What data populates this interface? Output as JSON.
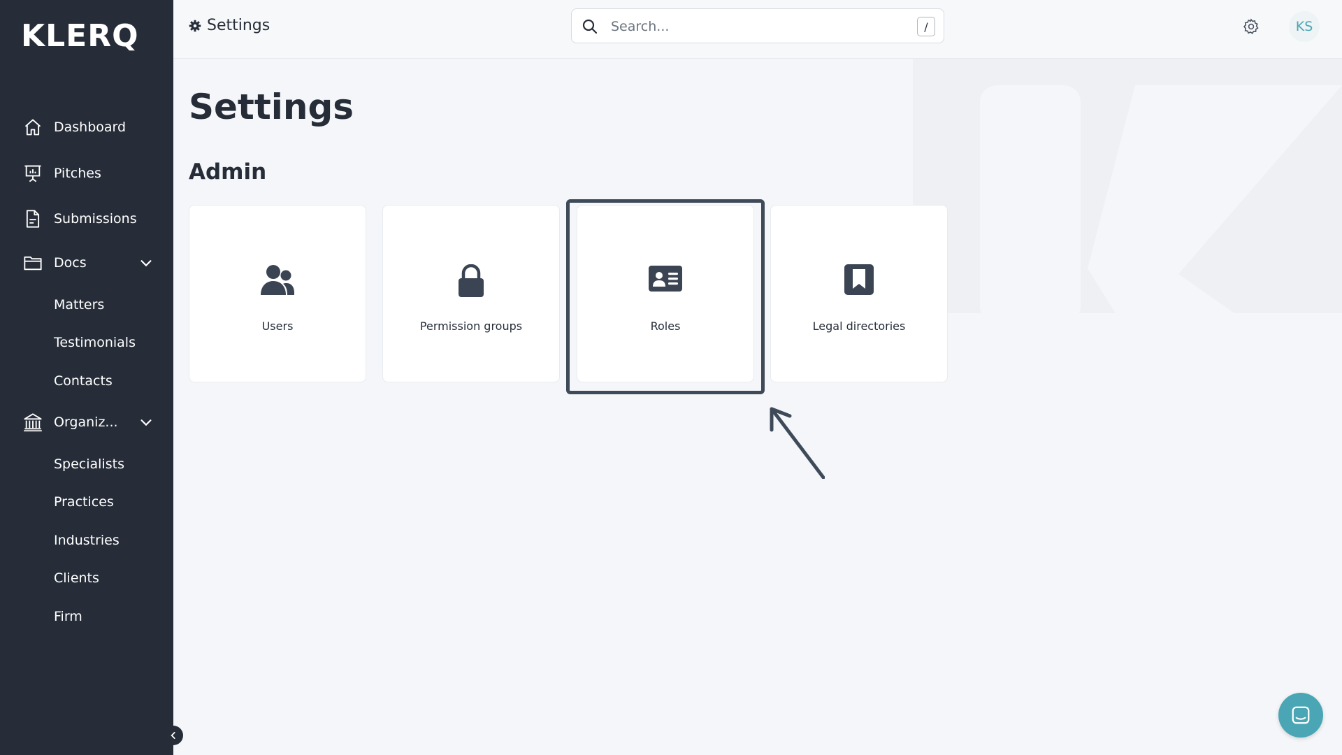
{
  "app": {
    "logo": "KLERQ"
  },
  "sidebar": {
    "items": [
      {
        "label": "Dashboard",
        "icon": "home-icon"
      },
      {
        "label": "Pitches",
        "icon": "presentation-icon"
      },
      {
        "label": "Submissions",
        "icon": "document-icon"
      },
      {
        "label": "Docs",
        "icon": "folder-icon",
        "expanded": true,
        "children": [
          "Matters",
          "Testimonials",
          "Contacts"
        ]
      },
      {
        "label": "Organiz...",
        "icon": "building-icon",
        "expanded": true,
        "children": [
          "Specialists",
          "Practices",
          "Industries",
          "Clients",
          "Firm"
        ]
      }
    ]
  },
  "header": {
    "breadcrumb": "Settings",
    "search": {
      "placeholder": "Search...",
      "shortcut": "/"
    },
    "avatar_initials": "KS"
  },
  "main": {
    "title": "Settings",
    "section": "Admin",
    "cards": [
      {
        "label": "Users",
        "icon": "users-icon"
      },
      {
        "label": "Permission groups",
        "icon": "lock-icon"
      },
      {
        "label": "Roles",
        "icon": "id-card-icon",
        "highlighted": true
      },
      {
        "label": "Legal directories",
        "icon": "bookmark-icon"
      }
    ]
  },
  "colors": {
    "sidebar_bg": "#262d38",
    "page_bg": "#f4f6f9",
    "accent": "#4aa6b4",
    "highlight_border": "#3f4a59"
  }
}
